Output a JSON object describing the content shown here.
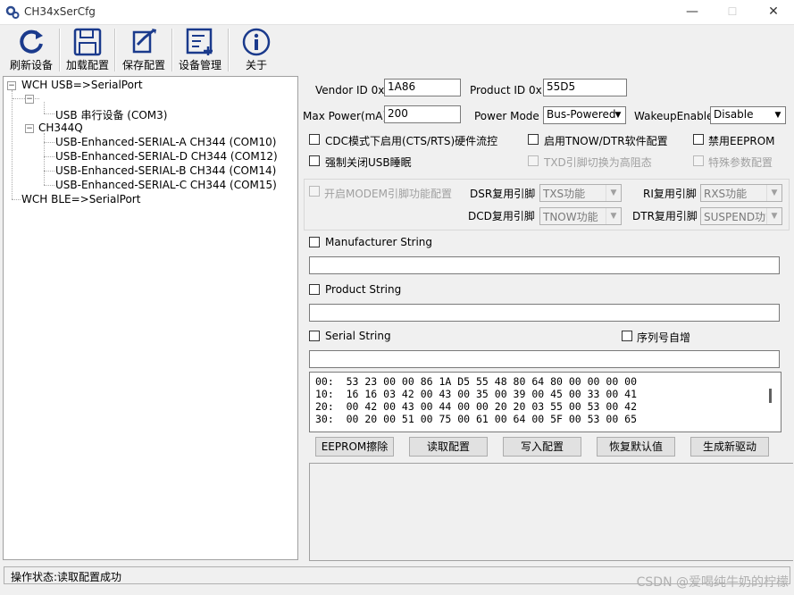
{
  "window": {
    "title": "CH34xSerCfg",
    "minimize": "—",
    "maximize": "☐",
    "close": "✕"
  },
  "toolbar": {
    "buttons": [
      {
        "label": "刷新设备",
        "icon": "refresh-icon"
      },
      {
        "label": "加载配置",
        "icon": "floppy-icon"
      },
      {
        "label": "保存配置",
        "icon": "save-icon"
      },
      {
        "label": "设备管理",
        "icon": "device-manager-icon"
      },
      {
        "label": "关于",
        "icon": "info-icon"
      }
    ]
  },
  "tree": {
    "root1": "WCH USB=>SerialPort",
    "child_usb": "USB 串行设备 (COM3)",
    "group_ch344q": "CH344Q",
    "ports": [
      "USB-Enhanced-SERIAL-A CH344 (COM10)",
      "USB-Enhanced-SERIAL-D CH344 (COM12)",
      "USB-Enhanced-SERIAL-B CH344 (COM14)",
      "USB-Enhanced-SERIAL-C CH344 (COM15)"
    ],
    "root2": "WCH BLE=>SerialPort"
  },
  "config": {
    "vendor_label": "Vendor ID 0x",
    "vendor_value": "1A86",
    "product_label": "Product ID 0x",
    "product_value": "55D5",
    "maxpower_label": "Max Power(mA)",
    "maxpower_value": "200",
    "powermode_label": "Power Mode",
    "powermode_value": "Bus-Powered",
    "wakeup_label": "WakeupEnable",
    "wakeup_value": "Disable",
    "cdc_flow": "CDC模式下启用(CTS/RTS)硬件流控",
    "tnow_dtr": "启用TNOW/DTR软件配置",
    "disable_eeprom": "禁用EEPROM",
    "force_close_sleep": "强制关闭USB睡眠",
    "txd_highz": "TXD引脚切换为高阻态",
    "special_param": "特殊参数配置"
  },
  "modem": {
    "enable_label": "开启MODEM引脚功能配置",
    "dsr_label": "DSR复用引脚",
    "dsr_value": "TXS功能",
    "ri_label": "RI复用引脚",
    "ri_value": "RXS功能",
    "dcd_label": "DCD复用引脚",
    "dcd_value": "TNOW功能",
    "dtr_label": "DTR复用引脚",
    "dtr_value": "SUSPEND功能"
  },
  "strings": {
    "manufacturer_label": "Manufacturer String",
    "manufacturer_value": "",
    "product_label": "Product String",
    "product_value": "",
    "serial_label": "Serial String",
    "serial_value": "",
    "serial_autoinc": "序列号自增"
  },
  "hex": {
    "lines": [
      "00:  53 23 00 00 86 1A D5 55 48 80 64 80 00 00 00 00",
      "10:  16 16 03 42 00 43 00 35 00 39 00 45 00 33 00 41",
      "20:  00 42 00 43 00 44 00 00 20 20 03 55 00 53 00 42",
      "30:  00 20 00 51 00 75 00 61 00 64 00 5F 00 53 00 65"
    ]
  },
  "actions": {
    "eeprom_erase": "EEPROM擦除",
    "read_config": "读取配置",
    "write_config": "写入配置",
    "restore_default": "恢复默认值",
    "generate_driver": "生成新驱动"
  },
  "status": {
    "text": "操作状态:读取配置成功"
  },
  "watermark": "CSDN @爱喝纯牛奶的柠檬"
}
